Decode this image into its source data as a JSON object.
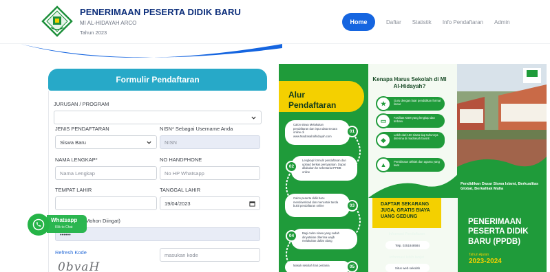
{
  "brand": {
    "title": "PENERIMAAN PESERTA DIDIK BARU",
    "school": "MI AL-HIDAYAH ARCO",
    "year": "Tahun 2023",
    "logo_icon": "school-crest-icon"
  },
  "nav": {
    "items": [
      "Home",
      "Daftar",
      "Statistik",
      "Info Pendaftaran",
      "Admin"
    ],
    "active": "Home",
    "accent": "#1565e0"
  },
  "form": {
    "title": "Formulir Pendaftaran",
    "jurusan": {
      "label": "JURUSAN / PROGRAM",
      "value": ""
    },
    "jenis": {
      "label": "JENIS PENDAFTARAN",
      "value": "Siswa Baru"
    },
    "nisn": {
      "label": "NISN* Sebagai Username Anda",
      "placeholder": "NISN"
    },
    "nama": {
      "label": "NAMA LENGKAP*",
      "placeholder": "Nama Lengkap"
    },
    "hp": {
      "label": "NO HANDPHONE",
      "placeholder": "No HP Whatsapp"
    },
    "tempat": {
      "label": "TEMPAT LAHIR",
      "value": ""
    },
    "tanggal": {
      "label": "TANGGAL LAHIR",
      "value": "19/04/2023"
    },
    "password": {
      "label_tail": "Mohon Diingat)",
      "value": "••••••"
    },
    "refresh_label": "Refresh Kode",
    "captcha_placeholder": "masukan kode",
    "captcha_text": "0bvaH",
    "header_color": "#27a9c8"
  },
  "whatsapp": {
    "title": "Whatsapp",
    "subtitle": "Klik to Chat",
    "color": "#25b447"
  },
  "poster": {
    "alur_title_1": "Alur",
    "alur_title_2": "Pendaftaran",
    "steps": [
      {
        "num": "01",
        "text": "Calon siswa Melakukan pendaftaran dan input data secara online di www.Madrasahalhidayah.com"
      },
      {
        "num": "02",
        "text": "Lengkapi formulir pendaftaran dan upload berkas persyaratan. Dapat dilakukan ke sekretariat PPDB online"
      },
      {
        "num": "03",
        "text": "Calon peserta didik baru mendownload dan mencetak tanda bukti pendaftaran online"
      },
      {
        "num": "04",
        "text": "Bagi calon siswa yang sudah dinyatakan diterima wajib melakukan daftar ulang"
      },
      {
        "num": "05",
        "text": "Masuk sekolah hari pertama"
      }
    ],
    "why_title": "Kenapa Harus Sekolah di MI Al-Hidayah?",
    "why_items": [
      {
        "icon": "star-icon",
        "text": "Guru dengan latar pendidikan formal linear"
      },
      {
        "icon": "monitor-icon",
        "text": "Fasilitas KBM yang lengkap dan terbaru"
      },
      {
        "icon": "graduation-cap-icon",
        "text": "Lebih dari 150 siswa tiap tahunnya diterima di madrasah favorit"
      },
      {
        "icon": "mosque-icon",
        "text": "Pembinaan akhlak dan agama yang kuat"
      }
    ],
    "daftar_cta": "DAFTAR SEKARANG JUGA, GRATIS BIAYA UANG GEDUNG",
    "info_label": "Informasi Pendaftaran",
    "info_phone": "Telp. 0251848584",
    "info_more_label": "Informasi lebih lanjut",
    "info_site": "Situs web sekolah",
    "slogan": "Pendidikan Dasar Siswa Islami, Berkualitas Global, Berkahlak Mulia",
    "ppdb_title": "PENERIMAAN PESERTA DIDIK BARU (PPDB)",
    "tahun_label": "Tahun Ajaran",
    "tahun": "2023-2024",
    "colors": {
      "green": "#1f9b3a",
      "yellow": "#f4d000"
    }
  }
}
